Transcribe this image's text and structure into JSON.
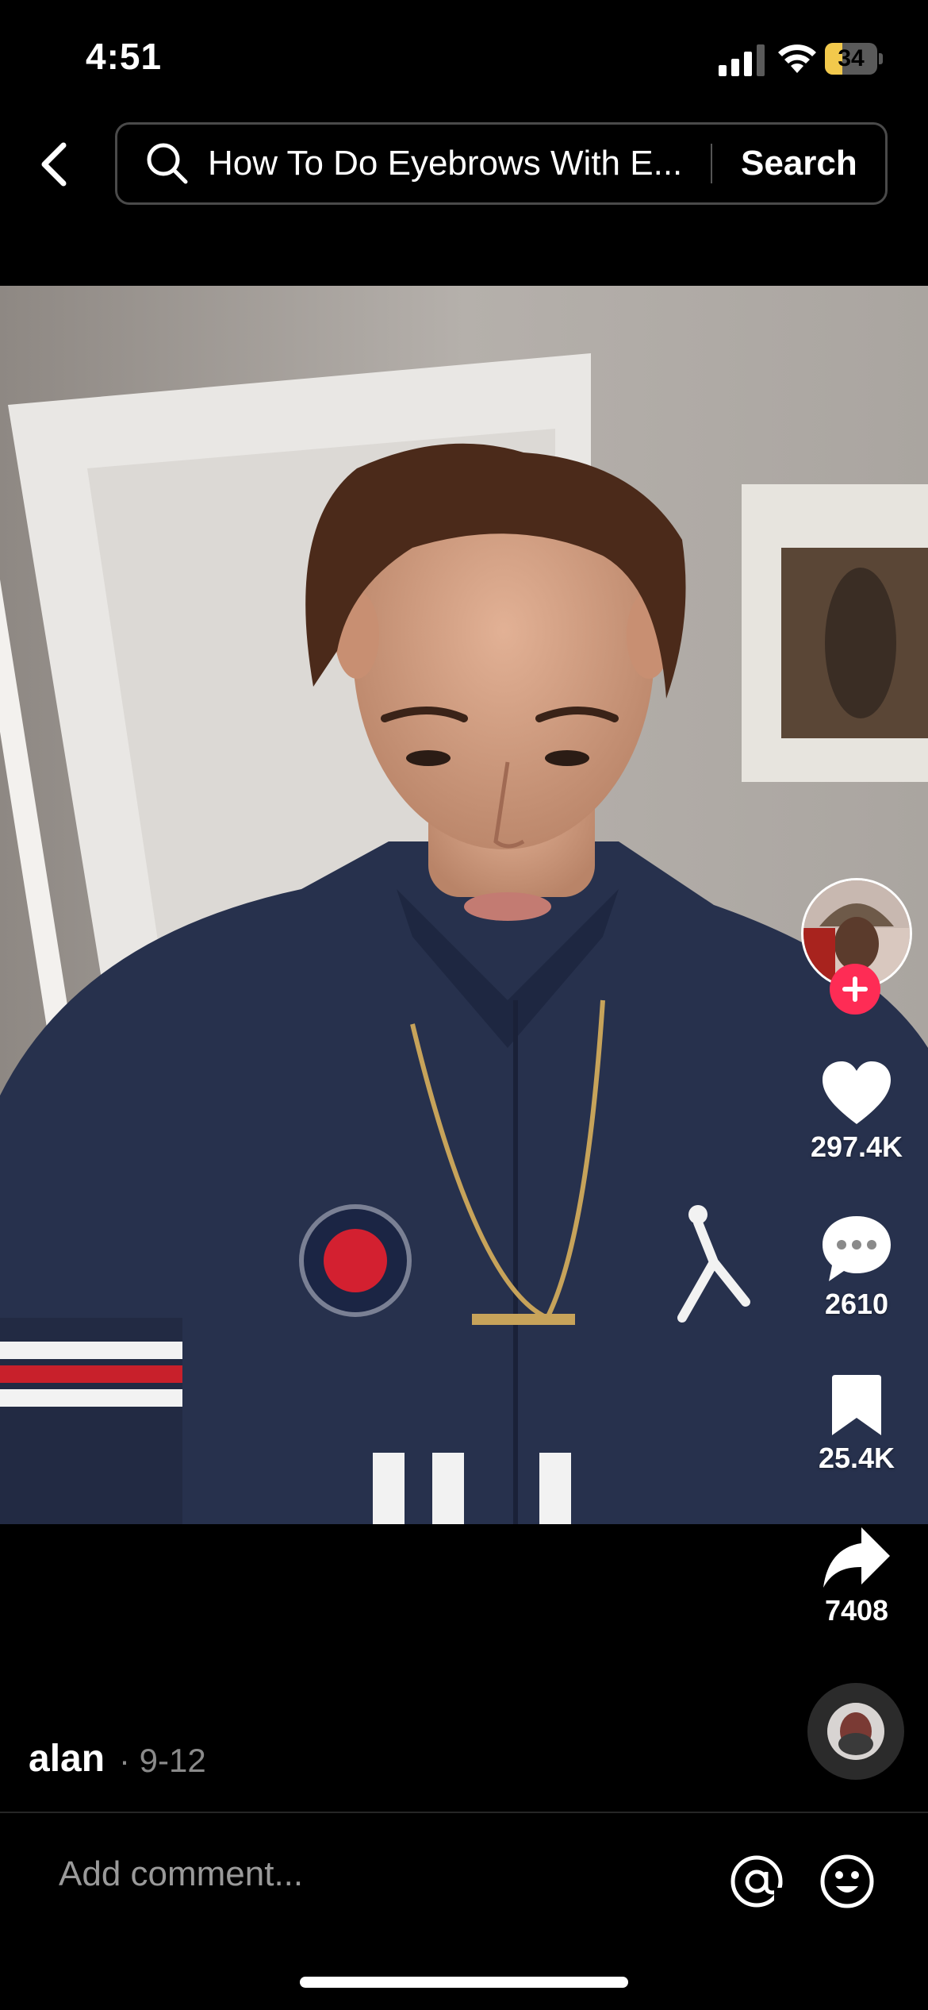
{
  "status_bar": {
    "time": "4:51",
    "battery": "34",
    "battery_level": 0.34
  },
  "header": {
    "search_query": "How To Do Eyebrows With E...",
    "search_button": "Search",
    "icons": [
      "back-arrow-icon",
      "search-icon"
    ]
  },
  "video": {
    "subject": "selfie-video"
  },
  "rail": {
    "likes": "297.4K",
    "comments": "2610",
    "saves": "25.4K",
    "shares": "7408",
    "icons": [
      "heart-icon",
      "comment-icon",
      "bookmark-icon",
      "share-icon",
      "plus-icon"
    ]
  },
  "post": {
    "author": "alan",
    "date": "· 9-12"
  },
  "comment_bar": {
    "placeholder": "Add comment...",
    "icons": [
      "at-mention-icon",
      "emoji-icon"
    ]
  },
  "colors": {
    "follow": "#fe2c55",
    "battery": "#f2c94c",
    "background": "#000000"
  }
}
